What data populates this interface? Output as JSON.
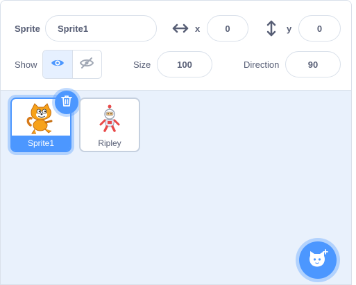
{
  "sprite_info": {
    "sprite_label": "Sprite",
    "sprite_name": "Sprite1",
    "x_label": "x",
    "x_value": "0",
    "y_label": "y",
    "y_value": "0",
    "show_label": "Show",
    "show_visible": true,
    "size_label": "Size",
    "size_value": "100",
    "direction_label": "Direction",
    "direction_value": "90"
  },
  "sprites": [
    {
      "name": "Sprite1",
      "selected": true,
      "thumbnail_icon": "cat-sprite-icon"
    },
    {
      "name": "Ripley",
      "selected": false,
      "thumbnail_icon": "robot-sprite-icon"
    }
  ],
  "actions": {
    "delete_icon": "trash-icon",
    "choose_sprite_icon": "cat-face-plus-icon"
  },
  "colors": {
    "accent": "#4c97ff",
    "pane_bg": "#e9f1fc",
    "text": "#575e75",
    "border": "#d9e0ea"
  }
}
